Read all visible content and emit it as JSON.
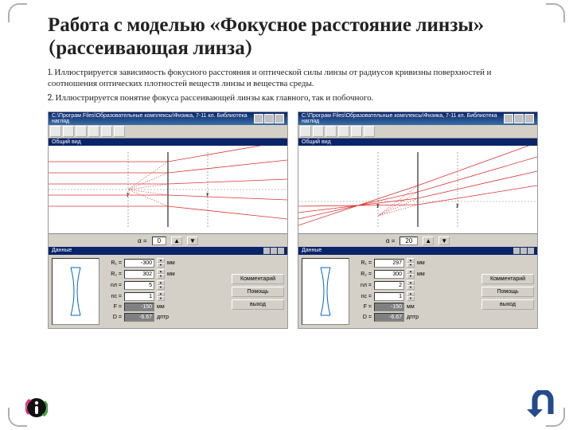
{
  "title": "Работа с моделью «Фокусное расстояние линзы» (рассеивающая линза)",
  "para1": "1. Иллюстрируется зависимость фокусного расстояния и оптической силы линзы от радиусов кривизны поверхностей и соотношения оптических плотностей веществ линзы и вещества среды.",
  "para2": "2. Иллюстрируется понятие фокуса рассеивающей линзы как главного, так и побочного.",
  "panel": {
    "path": "С:\\Програм Fіlеs\\Образовательные комплексы\\Физика, 7-11 кл. Библиотека нагляд",
    "view_sub": "Общий вид",
    "data_sub": "Данные",
    "alpha_label": "α =",
    "btn_comment": "Комментарий",
    "btn_help": "Помощь",
    "btn_exit": "выход",
    "labels": {
      "R1": "R₁ =",
      "R2": "R₂ =",
      "nl": "nл =",
      "nc": "nс =",
      "F": "F =",
      "D": "D ="
    },
    "units": {
      "mm": "мм",
      "dptr": "дптр"
    }
  },
  "left": {
    "alpha": "0",
    "R1": "-300",
    "R2": "302",
    "nl": "5",
    "nc": "1",
    "F": "-150",
    "D": "-6.67"
  },
  "right": {
    "alpha": "20",
    "R1": "297",
    "R2": "300",
    "nl": "2",
    "nc": "1",
    "F": "-150",
    "D": "-6.67"
  }
}
